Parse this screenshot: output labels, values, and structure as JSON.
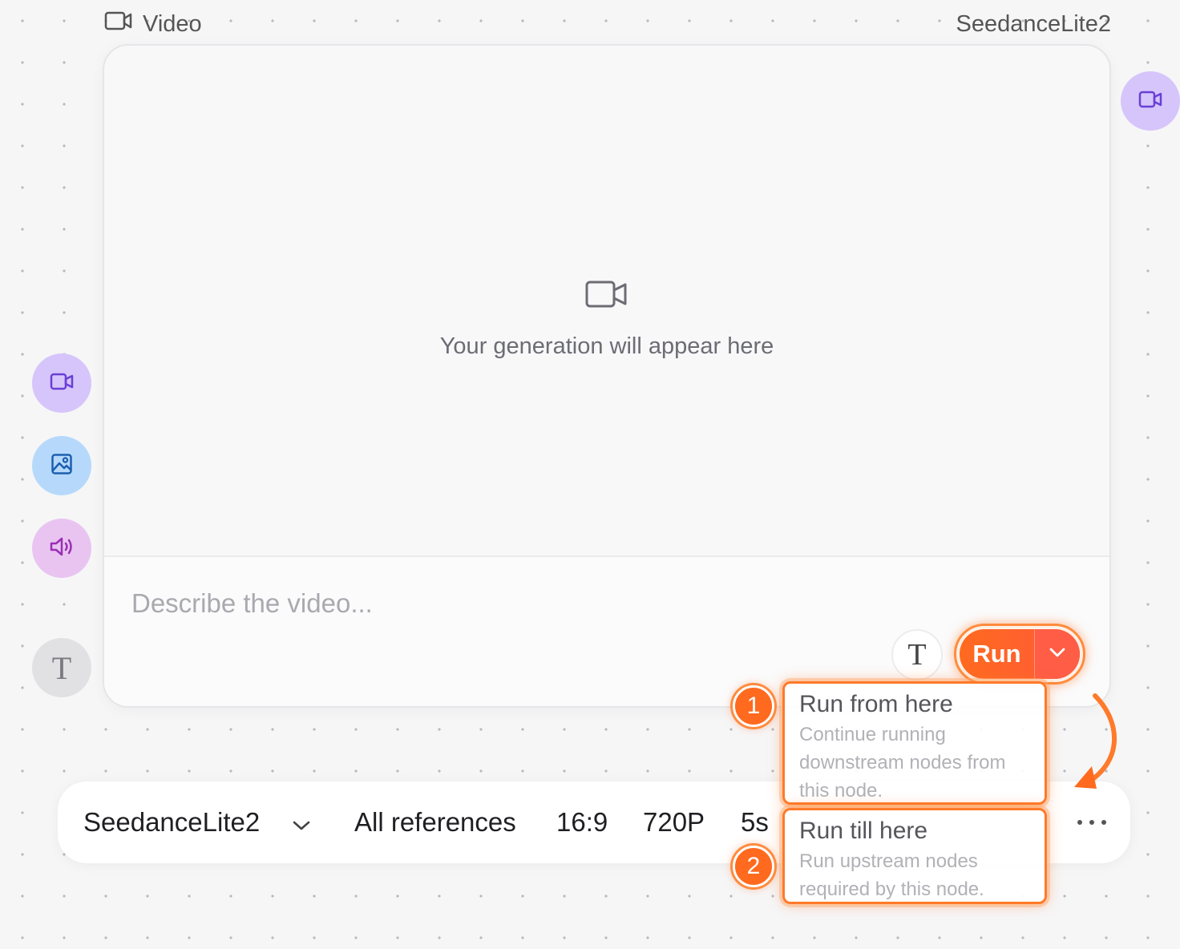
{
  "node": {
    "type_label": "Video",
    "model_label": "SeedanceLite2"
  },
  "preview": {
    "placeholder_text": "Your generation will appear here"
  },
  "prompt": {
    "placeholder": "Describe the video..."
  },
  "run": {
    "label": "Run"
  },
  "menu": {
    "options": [
      {
        "number": "1",
        "title": "Run from here",
        "description": "Continue running downstream nodes from this node."
      },
      {
        "number": "2",
        "title": "Run till here",
        "description": "Run upstream nodes required by this node."
      }
    ]
  },
  "settings": {
    "model": "SeedanceLite2",
    "references": "All references",
    "aspect_ratio": "16:9",
    "resolution": "720P",
    "duration": "5s"
  },
  "icons": {
    "input_video": "video-camera-icon",
    "input_image": "image-icon",
    "input_audio": "speaker-icon",
    "input_text": "text-T-icon",
    "output_video": "video-camera-icon"
  },
  "colors": {
    "run_accent": "#ff6a1f",
    "highlight": "#ff7a2a",
    "video_purple": "#d6c5fa",
    "image_blue": "#b6d9fb",
    "audio_pink": "#e9c4f1"
  }
}
